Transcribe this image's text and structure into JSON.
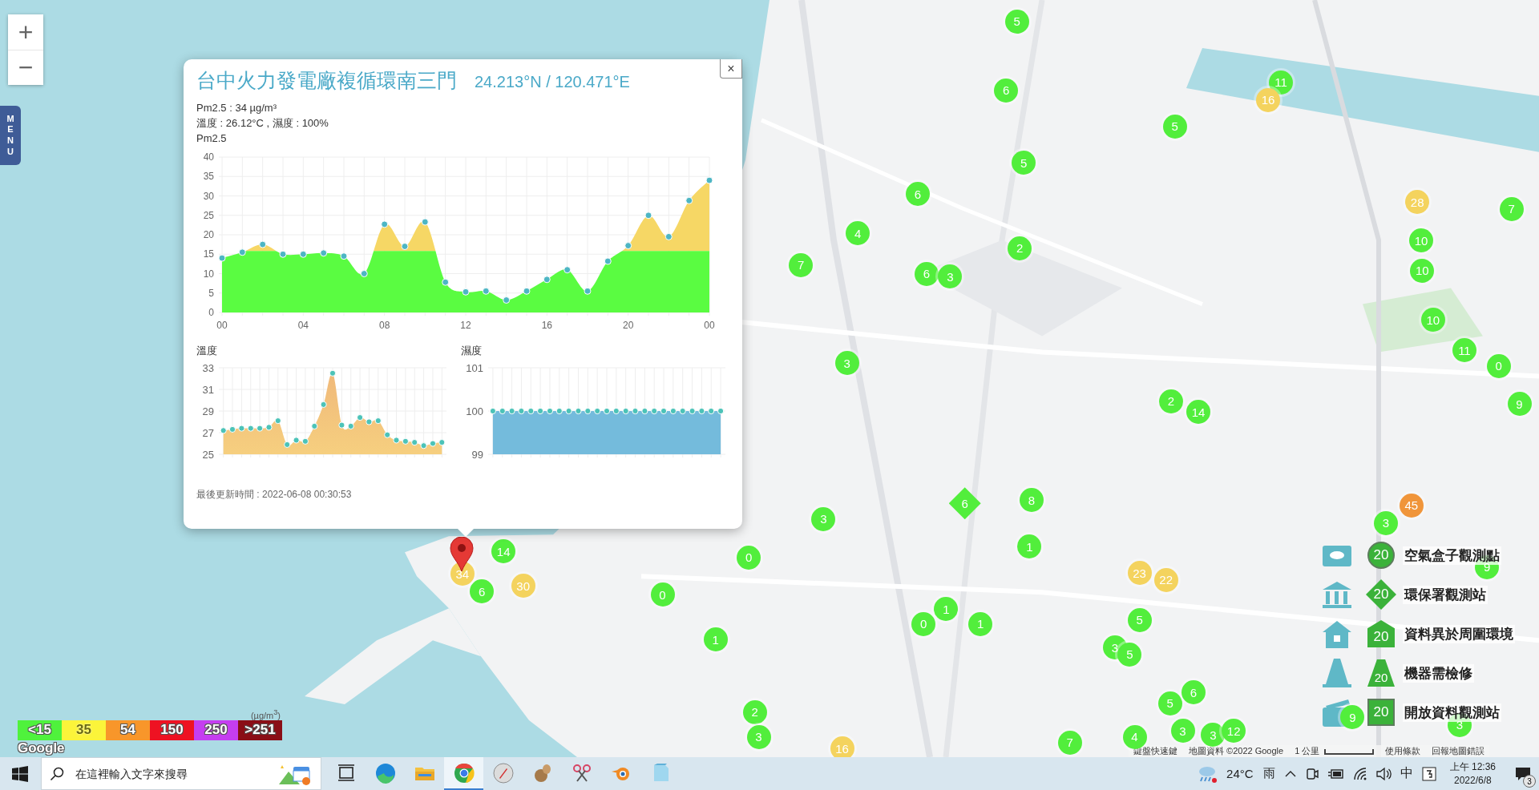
{
  "map_controls": {
    "zoom_in": "+",
    "zoom_out": "−",
    "menu": "MENU"
  },
  "popup": {
    "title": "台中火力發電廠複循環南三門",
    "coordinates": "24.213°N / 120.471°E",
    "close": "×",
    "readings": [
      "Pm2.5 : 34 µg/m³",
      "溫度 : 26.12°C , 濕度 : 100%"
    ],
    "pm_chart": {
      "chart_data": {
        "type": "area",
        "grid": true,
        "x": [
          0,
          1,
          2,
          3,
          4,
          5,
          6,
          7,
          8,
          9,
          10,
          11,
          12,
          13,
          14,
          15,
          16,
          17,
          18,
          19,
          20,
          21,
          22,
          23,
          24
        ],
        "xlim": [
          0,
          24
        ],
        "ylim": [
          0,
          40
        ],
        "xticks": [
          {
            "value": 0,
            "label": "00"
          },
          {
            "value": 4,
            "label": "04"
          },
          {
            "value": 8,
            "label": "08"
          },
          {
            "value": 12,
            "label": "12"
          },
          {
            "value": 16,
            "label": "16"
          },
          {
            "value": 20,
            "label": "20"
          },
          {
            "value": 24,
            "label": "00"
          }
        ],
        "yticks": [
          0,
          5,
          10,
          15,
          20,
          25,
          30,
          35,
          40
        ],
        "series": [
          {
            "name": "Pm2.5",
            "color": "#5afc41",
            "values": [
              14,
              15.5,
              17.5,
              15,
              15,
              15.3,
              14.5,
              10,
              22.7,
              17,
              23.3,
              7.8,
              5.3,
              5.5,
              3.2,
              5.5,
              8.5,
              11,
              5.5,
              13.2,
              17.2,
              25,
              19.5,
              28.8,
              34
            ]
          }
        ]
      }
    },
    "temp_chart": {
      "chart_data": {
        "type": "area",
        "grid": true,
        "ylim": [
          25,
          33
        ],
        "yticks": [
          25,
          27,
          29,
          31,
          33
        ],
        "series": [
          {
            "name": "溫度",
            "color": "#f6cf7f",
            "values": [
              27.2,
              27.3,
              27.4,
              27.4,
              27.4,
              27.5,
              28.1,
              25.9,
              26.3,
              26.2,
              27.6,
              29.6,
              32.5,
              27.7,
              27.6,
              28.4,
              28,
              28.1,
              26.8,
              26.3,
              26.2,
              26.1,
              25.8,
              26,
              26.1
            ]
          }
        ]
      }
    },
    "humidity_chart": {
      "chart_data": {
        "type": "area",
        "grid": true,
        "ylim": [
          99,
          101
        ],
        "yticks": [
          99,
          100,
          101
        ],
        "series": [
          {
            "name": "濕度",
            "color": "#74bbdc",
            "values": [
              100,
              100,
              100,
              100,
              100,
              100,
              100,
              100,
              100,
              100,
              100,
              100,
              100,
              100,
              100,
              100,
              100,
              100,
              100,
              100,
              100,
              100,
              100,
              100,
              100
            ]
          }
        ]
      }
    },
    "updated": "最後更新時間 : 2022-06-08 00:30:53"
  },
  "markers": [
    {
      "kind": "circle",
      "value": "5",
      "color": "#52ee3c"
    },
    {
      "kind": "circle",
      "value": "6",
      "color": "#52ee3c"
    },
    {
      "kind": "circle",
      "value": "11",
      "color": "#52ee3c"
    },
    {
      "kind": "circle",
      "value": "16",
      "color": "#f4d35e"
    },
    {
      "kind": "circle",
      "value": "5",
      "color": "#52ee3c"
    },
    {
      "kind": "circle",
      "value": "5",
      "color": "#52ee3c"
    },
    {
      "kind": "circle",
      "value": "6",
      "color": "#52ee3c"
    },
    {
      "kind": "circle",
      "value": "2",
      "color": "#52ee3c"
    },
    {
      "kind": "circle",
      "value": "4",
      "color": "#52ee3c"
    },
    {
      "kind": "circle",
      "value": "7",
      "color": "#52ee3c"
    },
    {
      "kind": "circle",
      "value": "6",
      "color": "#52ee3c"
    },
    {
      "kind": "circle",
      "value": "3",
      "color": "#52ee3c"
    },
    {
      "kind": "circle",
      "value": "28",
      "color": "#f4d35e"
    },
    {
      "kind": "circle",
      "value": "7",
      "color": "#52ee3c"
    },
    {
      "kind": "circle",
      "value": "10",
      "color": "#52ee3c"
    },
    {
      "kind": "circle",
      "value": "10",
      "color": "#52ee3c"
    },
    {
      "kind": "circle",
      "value": "10",
      "color": "#52ee3c"
    },
    {
      "kind": "circle",
      "value": "11",
      "color": "#52ee3c"
    },
    {
      "kind": "circle",
      "value": "0",
      "color": "#52ee3c"
    },
    {
      "kind": "circle",
      "value": "9",
      "color": "#52ee3c"
    },
    {
      "kind": "circle",
      "value": "3",
      "color": "#52ee3c"
    },
    {
      "kind": "circle",
      "value": "2",
      "color": "#52ee3c"
    },
    {
      "kind": "circle",
      "value": "14",
      "color": "#52ee3c"
    },
    {
      "kind": "diamond",
      "value": "6",
      "color": "#52ee3c"
    },
    {
      "kind": "circle",
      "value": "8",
      "color": "#52ee3c"
    },
    {
      "kind": "circle",
      "value": "1",
      "color": "#52ee3c"
    },
    {
      "kind": "circle",
      "value": "3",
      "color": "#52ee3c"
    },
    {
      "kind": "circle",
      "value": "45",
      "color": "#f0953a"
    },
    {
      "kind": "circle",
      "value": "3",
      "color": "#52ee3c"
    },
    {
      "kind": "circle",
      "value": "0",
      "color": "#52ee3c"
    },
    {
      "kind": "circle",
      "value": "14",
      "color": "#52ee3c"
    },
    {
      "kind": "circle",
      "value": "30",
      "color": "#f4d35e"
    },
    {
      "kind": "circle",
      "value": "6",
      "color": "#52ee3c"
    },
    {
      "kind": "circle",
      "value": "34",
      "color": "#f4d35e"
    },
    {
      "kind": "circle",
      "value": "0",
      "color": "#52ee3c"
    },
    {
      "kind": "circle",
      "value": "23",
      "color": "#f4d35e"
    },
    {
      "kind": "circle",
      "value": "22",
      "color": "#f4d35e"
    },
    {
      "kind": "circle",
      "value": "9",
      "color": "#52ee3c"
    },
    {
      "kind": "circle",
      "value": "1",
      "color": "#52ee3c"
    },
    {
      "kind": "circle",
      "value": "0",
      "color": "#52ee3c"
    },
    {
      "kind": "circle",
      "value": "1",
      "color": "#52ee3c"
    },
    {
      "kind": "circle",
      "value": "5",
      "color": "#52ee3c"
    },
    {
      "kind": "circle",
      "value": "3",
      "color": "#52ee3c"
    },
    {
      "kind": "circle",
      "value": "5",
      "color": "#52ee3c"
    },
    {
      "kind": "circle",
      "value": "1",
      "color": "#52ee3c"
    },
    {
      "kind": "circle",
      "value": "5",
      "color": "#52ee3c"
    },
    {
      "kind": "circle",
      "value": "6",
      "color": "#52ee3c"
    },
    {
      "kind": "circle",
      "value": "2",
      "color": "#52ee3c"
    },
    {
      "kind": "circle",
      "value": "3",
      "color": "#52ee3c"
    },
    {
      "kind": "circle",
      "value": "7",
      "color": "#52ee3c"
    },
    {
      "kind": "circle",
      "value": "4",
      "color": "#52ee3c"
    },
    {
      "kind": "circle",
      "value": "3",
      "color": "#52ee3c"
    },
    {
      "kind": "circle",
      "value": "3",
      "color": "#52ee3c"
    },
    {
      "kind": "circle",
      "value": "12",
      "color": "#52ee3c"
    },
    {
      "kind": "circle",
      "value": "9",
      "color": "#52ee3c"
    },
    {
      "kind": "circle",
      "value": "3",
      "color": "#52ee3c"
    },
    {
      "kind": "circle",
      "value": "16",
      "color": "#f4d35e"
    }
  ],
  "station_legend": [
    {
      "kind": "circle",
      "value": "20",
      "label": "空氣盒子觀測點"
    },
    {
      "kind": "diamond",
      "value": "20",
      "label": "環保署觀測站"
    },
    {
      "kind": "house",
      "value": "20",
      "label": "資料異於周圍環境"
    },
    {
      "kind": "cone",
      "value": "20",
      "label": "機器需檢修"
    },
    {
      "kind": "square",
      "value": "20",
      "label": "開放資料觀測站"
    }
  ],
  "aqi_legend": {
    "unit": "(µg/m$^{3}$)",
    "items": [
      {
        "label": "<15",
        "color": "#4ff23c"
      },
      {
        "label": "35",
        "color": "#fbf43a"
      },
      {
        "label": "54",
        "color": "#f8962a"
      },
      {
        "label": "150",
        "color": "#ee1222"
      },
      {
        "label": "250",
        "color": "#c53ef0"
      },
      {
        "label": ">251",
        "color": "#8a0e16"
      }
    ]
  },
  "map_logo": "Google",
  "attribution": [
    "鍵盤快速鍵",
    "地圖資料 ©2022 Google",
    "1 公里",
    "使用條款",
    "回報地圖錯誤"
  ],
  "taskbar": {
    "search_placeholder": "在這裡輸入文字來搜尋",
    "apps": [
      {
        "kind": "taskview",
        "selected": false
      },
      {
        "kind": "swirl",
        "selected": false
      },
      {
        "kind": "folder",
        "selected": false
      },
      {
        "kind": "ring",
        "selected": true
      },
      {
        "kind": "compass",
        "selected": false
      },
      {
        "kind": "animal",
        "selected": false
      },
      {
        "kind": "scissors",
        "selected": false
      },
      {
        "kind": "orbit",
        "selected": false
      },
      {
        "kind": "notepad",
        "selected": false
      }
    ],
    "temperature": "24°C",
    "weather": "雨",
    "ime": "中",
    "time": "上午 12:36",
    "date": "2022/6/8",
    "notifications": "3"
  }
}
